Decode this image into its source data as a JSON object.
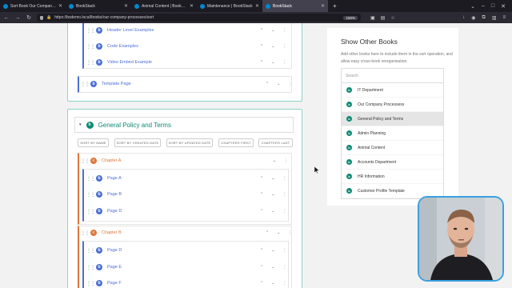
{
  "browser": {
    "tabs": [
      {
        "title": "Sort Book Our Company Pr...",
        "active": false
      },
      {
        "title": "BookStack",
        "active": false
      },
      {
        "title": "Animal Content | BookStack",
        "active": false
      },
      {
        "title": "Maintenance | BookStack",
        "active": false
      },
      {
        "title": "BookStack",
        "active": true
      }
    ],
    "url": "https://bsdemo.local/books/our-company-processes/sort",
    "zoom": "150%"
  },
  "sort_tree": {
    "top_pages": [
      "Header Level Examples",
      "Code Examples",
      "Video Embed Example"
    ],
    "template_page": "Template Page",
    "book_title": "General Policy and Terms",
    "sort_buttons": [
      "SORT BY NAME",
      "SORT BY CREATED DATE",
      "SORT BY UPDATED DATE",
      "CHAPTERS FIRST",
      "CHAPTERS LAST"
    ],
    "chapter_a": {
      "name": "Chapter A",
      "pages": [
        "Page A",
        "Page B",
        "Page D"
      ]
    },
    "chapter_b": {
      "name": "Chapter B",
      "pages": [
        "Page D",
        "Page E",
        "Page F"
      ]
    }
  },
  "panel": {
    "title": "Show Other Books",
    "description": "Add other books here to include them in the sort operation, and allow easy cross-book reorganisation.",
    "search_placeholder": "Search",
    "books": [
      "IT Department",
      "Our Company Processess",
      "General Policy and Terms",
      "Admin Planning",
      "Animal Content",
      "Accounts Department",
      "HR Information",
      "Customer Profile Template"
    ],
    "selected_index": 2
  },
  "colors": {
    "book": "#0a8a72",
    "chapter": "#e0763c",
    "page": "#4c6fd6",
    "accent": "#8ad3c7"
  }
}
